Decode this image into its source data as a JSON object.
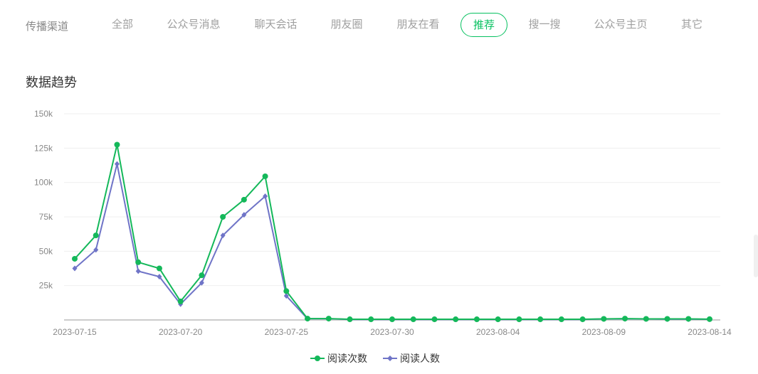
{
  "nav": {
    "channel_label": "传播渠道",
    "tabs": [
      {
        "label": "全部",
        "active": false
      },
      {
        "label": "公众号消息",
        "active": false
      },
      {
        "label": "聊天会话",
        "active": false
      },
      {
        "label": "朋友圈",
        "active": false
      },
      {
        "label": "朋友在看",
        "active": false
      },
      {
        "label": "推荐",
        "active": true
      },
      {
        "label": "搜一搜",
        "active": false
      },
      {
        "label": "公众号主页",
        "active": false
      },
      {
        "label": "其它",
        "active": false
      }
    ]
  },
  "section_title": "数据趋势",
  "colors": {
    "accent": "#07c160",
    "series_reads": "#14b85a",
    "series_readers": "#6f74c7"
  },
  "chart_data": {
    "type": "line",
    "x": [
      "2023-07-15",
      "2023-07-16",
      "2023-07-17",
      "2023-07-18",
      "2023-07-19",
      "2023-07-20",
      "2023-07-21",
      "2023-07-22",
      "2023-07-23",
      "2023-07-24",
      "2023-07-25",
      "2023-07-26",
      "2023-07-27",
      "2023-07-28",
      "2023-07-29",
      "2023-07-30",
      "2023-07-31",
      "2023-08-01",
      "2023-08-02",
      "2023-08-03",
      "2023-08-04",
      "2023-08-05",
      "2023-08-06",
      "2023-08-07",
      "2023-08-08",
      "2023-08-09",
      "2023-08-10",
      "2023-08-11",
      "2023-08-12",
      "2023-08-13",
      "2023-08-14"
    ],
    "x_tick_labels": [
      "2023-07-15",
      "2023-07-20",
      "2023-07-25",
      "2023-07-30",
      "2023-08-04",
      "2023-08-09",
      "2023-08-14"
    ],
    "y_tick_labels": [
      "25k",
      "50k",
      "75k",
      "100k",
      "125k",
      "150k"
    ],
    "ylim": [
      0,
      150000
    ],
    "grid": true,
    "legend_position": "bottom-center",
    "series": [
      {
        "name": "阅读次数",
        "marker": "circle",
        "values": [
          44500,
          61500,
          127500,
          42000,
          37500,
          13500,
          32500,
          75000,
          87500,
          104500,
          21000,
          1000,
          1000,
          500,
          500,
          500,
          500,
          500,
          500,
          500,
          500,
          500,
          500,
          500,
          500,
          800,
          1000,
          800,
          800,
          800,
          600
        ]
      },
      {
        "name": "阅读人数",
        "marker": "diamond",
        "values": [
          37500,
          51000,
          113500,
          35500,
          31500,
          11500,
          27000,
          61500,
          76500,
          90000,
          17500,
          900,
          900,
          400,
          400,
          400,
          400,
          400,
          400,
          400,
          400,
          400,
          400,
          400,
          400,
          700,
          800,
          700,
          600,
          600,
          500
        ]
      }
    ]
  }
}
